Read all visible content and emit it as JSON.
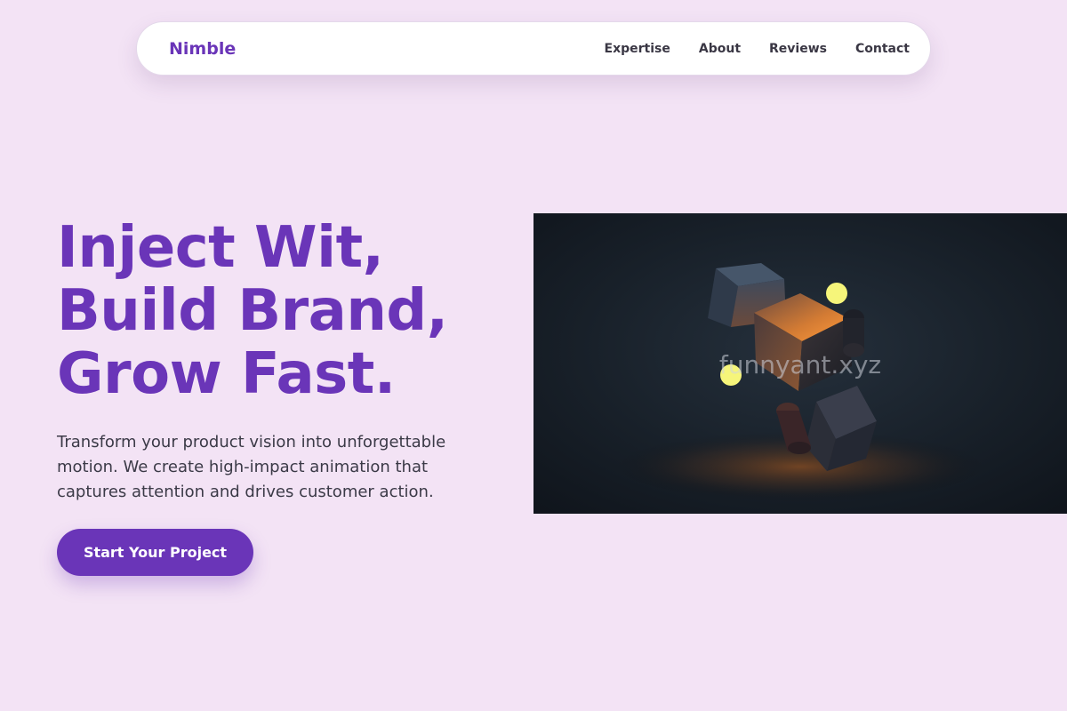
{
  "brand": {
    "name": "Nimble"
  },
  "nav": {
    "links": [
      "Expertise",
      "About",
      "Reviews",
      "Contact"
    ]
  },
  "hero": {
    "headline": [
      "Inject Wit,",
      "Build Brand,",
      "Grow Fast."
    ],
    "subtext": "Transform your product vision into unforgettable motion. We create high-impact animation that captures attention and drives customer action.",
    "cta_label": "Start Your Project",
    "image_watermark": "funnyant.xyz"
  },
  "colors": {
    "background": "#f3e3f5",
    "accent": "#6a35b8",
    "nav_bg": "#ffffff",
    "text_dark": "#3b3a47",
    "image_bg": "#161c26",
    "glow_orange": "#e0742a",
    "dot_yellow": "#f6f57a"
  },
  "icons": {
    "hero_image_subject": "floating-cubes-illustration"
  }
}
